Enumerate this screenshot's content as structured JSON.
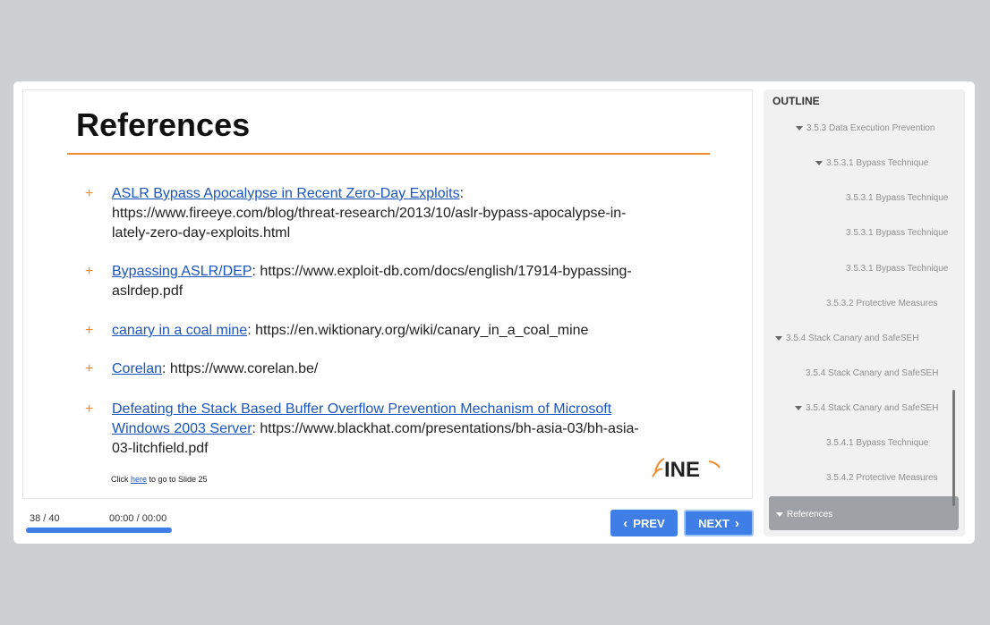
{
  "slide": {
    "title": "References",
    "references": [
      {
        "link": "ASLR Bypass Apocalypse in Recent Zero-Day Exploits",
        "text": ": https://www.fireeye.com/blog/threat-research/2013/10/aslr-bypass-apocalypse-in-lately-zero-day-exploits.html"
      },
      {
        "link": "Bypassing ASLR/DEP",
        "text": ": https://www.exploit-db.com/docs/english/17914-bypassing-aslrdep.pdf"
      },
      {
        "link": "canary in a coal mine",
        "text": ": https://en.wiktionary.org/wiki/canary_in_a_coal_mine"
      },
      {
        "link": "Corelan",
        "text": ": https://www.corelan.be/"
      },
      {
        "link": "Defeating the Stack Based Buffer Overflow Prevention Mechanism of Microsoft Windows 2003 Server",
        "text": ": https://www.blackhat.com/presentations/bh-asia-03/bh-asia-03-litchfield.pdf"
      }
    ],
    "bullet": "+",
    "click_prefix": "Click ",
    "click_link": "here",
    "click_suffix": " to go to Slide 25",
    "logo_text": "INE"
  },
  "player": {
    "counter": "38 / 40",
    "time": "00:00 / 00:00",
    "progress": 1.0,
    "prev_label": "PREV",
    "next_label": "NEXT"
  },
  "outline": {
    "heading": "OUTLINE",
    "items": [
      {
        "label": "3.5.3 Data Execution Prevention",
        "expanded": true
      },
      {
        "label": "3.5.3.1 Bypass Technique",
        "expanded": true
      },
      {
        "label": "3.5.3.1 Bypass Technique",
        "expanded": false
      },
      {
        "label": "3.5.3.1 Bypass Technique",
        "expanded": false
      },
      {
        "label": "3.5.3.1 Bypass Technique",
        "expanded": false
      },
      {
        "label": "3.5.3.2 Protective Measures",
        "expanded": false
      },
      {
        "label": "3.5.4 Stack Canary and SafeSEH",
        "expanded": true
      },
      {
        "label": "3.5.4 Stack Canary and SafeSEH",
        "expanded": false
      },
      {
        "label": "3.5.4 Stack Canary and SafeSEH",
        "expanded": true
      },
      {
        "label": "3.5.4.1 Bypass Technique",
        "expanded": false
      },
      {
        "label": "3.5.4.2 Protective Measures",
        "expanded": false
      }
    ],
    "active_item": "References"
  },
  "colors": {
    "accent": "#3e7ee6",
    "rule": "#f28b30",
    "link": "#1a55c0"
  }
}
